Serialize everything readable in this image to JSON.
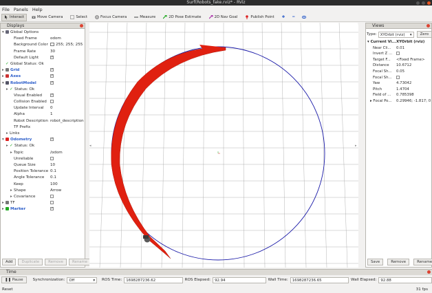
{
  "window": {
    "title": "Surf(Robots_fake.rviz* - RViz"
  },
  "menu": [
    "File",
    "Panels",
    "Help"
  ],
  "toolbar": {
    "interact": "Interact",
    "move_camera": "Move Camera",
    "select": "Select",
    "focus_camera": "Focus Camera",
    "measure": "Measure",
    "pose_estimate": "2D Pose Estimate",
    "nav_goal": "2D Nav Goal",
    "publish_point": "Publish Point"
  },
  "displays": {
    "title": "Displays",
    "rows": [
      {
        "k": "Global Options",
        "v": "",
        "indent": 0,
        "expander": "▾",
        "icon": "gear-icon",
        "check": null,
        "blue": false
      },
      {
        "k": "Fixed Frame",
        "v": "odom",
        "indent": 2,
        "expander": "",
        "icon": "",
        "check": null,
        "blue": false
      },
      {
        "k": "Background Color",
        "v": "255; 255; 255",
        "indent": 2,
        "expander": "",
        "icon": "",
        "check": null,
        "blue": false,
        "swatch": true
      },
      {
        "k": "Frame Rate",
        "v": "30",
        "indent": 2,
        "expander": "",
        "icon": "",
        "check": null,
        "blue": false
      },
      {
        "k": "Default Light",
        "v": "",
        "indent": 2,
        "expander": "",
        "icon": "",
        "check": true,
        "blue": false
      },
      {
        "k": "Global Status: Ok",
        "v": "",
        "indent": 0,
        "expander": "",
        "icon": "check-icon",
        "check": null,
        "blue": false
      },
      {
        "k": "Grid",
        "v": "",
        "indent": 0,
        "expander": "▸",
        "icon": "grid-icon",
        "check": true,
        "blue": true
      },
      {
        "k": "Axes",
        "v": "",
        "indent": 0,
        "expander": "▸",
        "icon": "axes-icon",
        "check": true,
        "blue": true
      },
      {
        "k": "RobotModel",
        "v": "",
        "indent": 0,
        "expander": "▾",
        "icon": "robot-icon",
        "check": true,
        "blue": true
      },
      {
        "k": "Status: Ok",
        "v": "",
        "indent": 1,
        "expander": "▸",
        "icon": "check-icon",
        "check": null,
        "blue": false
      },
      {
        "k": "Visual Enabled",
        "v": "",
        "indent": 2,
        "expander": "",
        "icon": "",
        "check": true,
        "blue": false
      },
      {
        "k": "Collision Enabled",
        "v": "",
        "indent": 2,
        "expander": "",
        "icon": "",
        "check": false,
        "blue": false
      },
      {
        "k": "Update Interval",
        "v": "0",
        "indent": 2,
        "expander": "",
        "icon": "",
        "check": null,
        "blue": false
      },
      {
        "k": "Alpha",
        "v": "1",
        "indent": 2,
        "expander": "",
        "icon": "",
        "check": null,
        "blue": false
      },
      {
        "k": "Robot Description",
        "v": "robot_description",
        "indent": 2,
        "expander": "",
        "icon": "",
        "check": null,
        "blue": false
      },
      {
        "k": "TF Prefix",
        "v": "",
        "indent": 2,
        "expander": "",
        "icon": "",
        "check": null,
        "blue": false
      },
      {
        "k": "Links",
        "v": "",
        "indent": 1,
        "expander": "▸",
        "icon": "",
        "check": null,
        "blue": false
      },
      {
        "k": "Odometry",
        "v": "",
        "indent": 0,
        "expander": "▾",
        "icon": "odometry-icon",
        "check": true,
        "blue": true
      },
      {
        "k": "Status: Ok",
        "v": "",
        "indent": 1,
        "expander": "▸",
        "icon": "check-icon",
        "check": null,
        "blue": false
      },
      {
        "k": "Topic",
        "v": "/odom",
        "indent": 2,
        "expander": "▸",
        "icon": "",
        "check": null,
        "blue": false
      },
      {
        "k": "Unreliable",
        "v": "",
        "indent": 2,
        "expander": "",
        "icon": "",
        "check": false,
        "blue": false
      },
      {
        "k": "Queue Size",
        "v": "10",
        "indent": 2,
        "expander": "",
        "icon": "",
        "check": null,
        "blue": false
      },
      {
        "k": "Position Tolerance",
        "v": "0.1",
        "indent": 2,
        "expander": "",
        "icon": "",
        "check": null,
        "blue": false
      },
      {
        "k": "Angle Tolerance",
        "v": "0.1",
        "indent": 2,
        "expander": "",
        "icon": "",
        "check": null,
        "blue": false
      },
      {
        "k": "Keep",
        "v": "100",
        "indent": 2,
        "expander": "",
        "icon": "",
        "check": null,
        "blue": false
      },
      {
        "k": "Shape",
        "v": "Arrow",
        "indent": 2,
        "expander": "▸",
        "icon": "",
        "check": null,
        "blue": false
      },
      {
        "k": "Covariance",
        "v": "",
        "indent": 2,
        "expander": "▸",
        "icon": "",
        "check": false,
        "blue": false
      },
      {
        "k": "TF",
        "v": "",
        "indent": 0,
        "expander": "▸",
        "icon": "tf-icon",
        "check": false,
        "blue": false
      },
      {
        "k": "Marker",
        "v": "",
        "indent": 0,
        "expander": "▸",
        "icon": "marker-icon",
        "check": true,
        "blue": true
      }
    ],
    "buttons": {
      "add": "Add",
      "duplicate": "Duplicate",
      "remove": "Remove",
      "rename": "Rename"
    }
  },
  "views": {
    "title": "Views",
    "type_label": "Type:",
    "type_value": "XYOrbit (rviz)",
    "zero": "Zero",
    "rows": [
      {
        "k": "Current Vi...",
        "v": "XYOrbit (rviz)",
        "indent": 0,
        "bold": true
      },
      {
        "k": "Near Cli...",
        "v": "0.01",
        "indent": 2,
        "bold": false
      },
      {
        "k": "Invert Z ...",
        "v": "",
        "indent": 2,
        "bold": false,
        "check": false
      },
      {
        "k": "Target F...",
        "v": "<Fixed Frame>",
        "indent": 2,
        "bold": false
      },
      {
        "k": "Distance",
        "v": "10.6712",
        "indent": 2,
        "bold": false
      },
      {
        "k": "Focal Sh...",
        "v": "0.05",
        "indent": 2,
        "bold": false
      },
      {
        "k": "Focal Sh...",
        "v": "",
        "indent": 2,
        "bold": false,
        "check": false
      },
      {
        "k": "Yaw",
        "v": "4.73042",
        "indent": 2,
        "bold": false
      },
      {
        "k": "Pitch",
        "v": "1.4704",
        "indent": 2,
        "bold": false
      },
      {
        "k": "Field of ...",
        "v": "0.785398",
        "indent": 2,
        "bold": false
      },
      {
        "k": "Focal Po...",
        "v": "0.29946; -1.817; 0",
        "indent": 1,
        "bold": false
      }
    ],
    "buttons": {
      "save": "Save",
      "remove": "Remove",
      "rename": "Rename"
    }
  },
  "time": {
    "title": "Time",
    "pause": "Pause",
    "sync_label": "Synchronization:",
    "sync_value": "Off",
    "ros_time_label": "ROS Time:",
    "ros_time": "1698287236.62",
    "ros_elapsed_label": "ROS Elapsed:",
    "ros_elapsed": "92.94",
    "wall_time_label": "Wall Time:",
    "wall_time": "1698287236.65",
    "wall_elapsed_label": "Wall Elapsed:",
    "wall_elapsed": "92.88"
  },
  "status": {
    "left": "Reset",
    "fps": "31 fps"
  },
  "colors": {
    "path": "#1a1aa8",
    "odometry": "#e02010",
    "grid": "#a0a0a0",
    "background": "#ffffff"
  }
}
